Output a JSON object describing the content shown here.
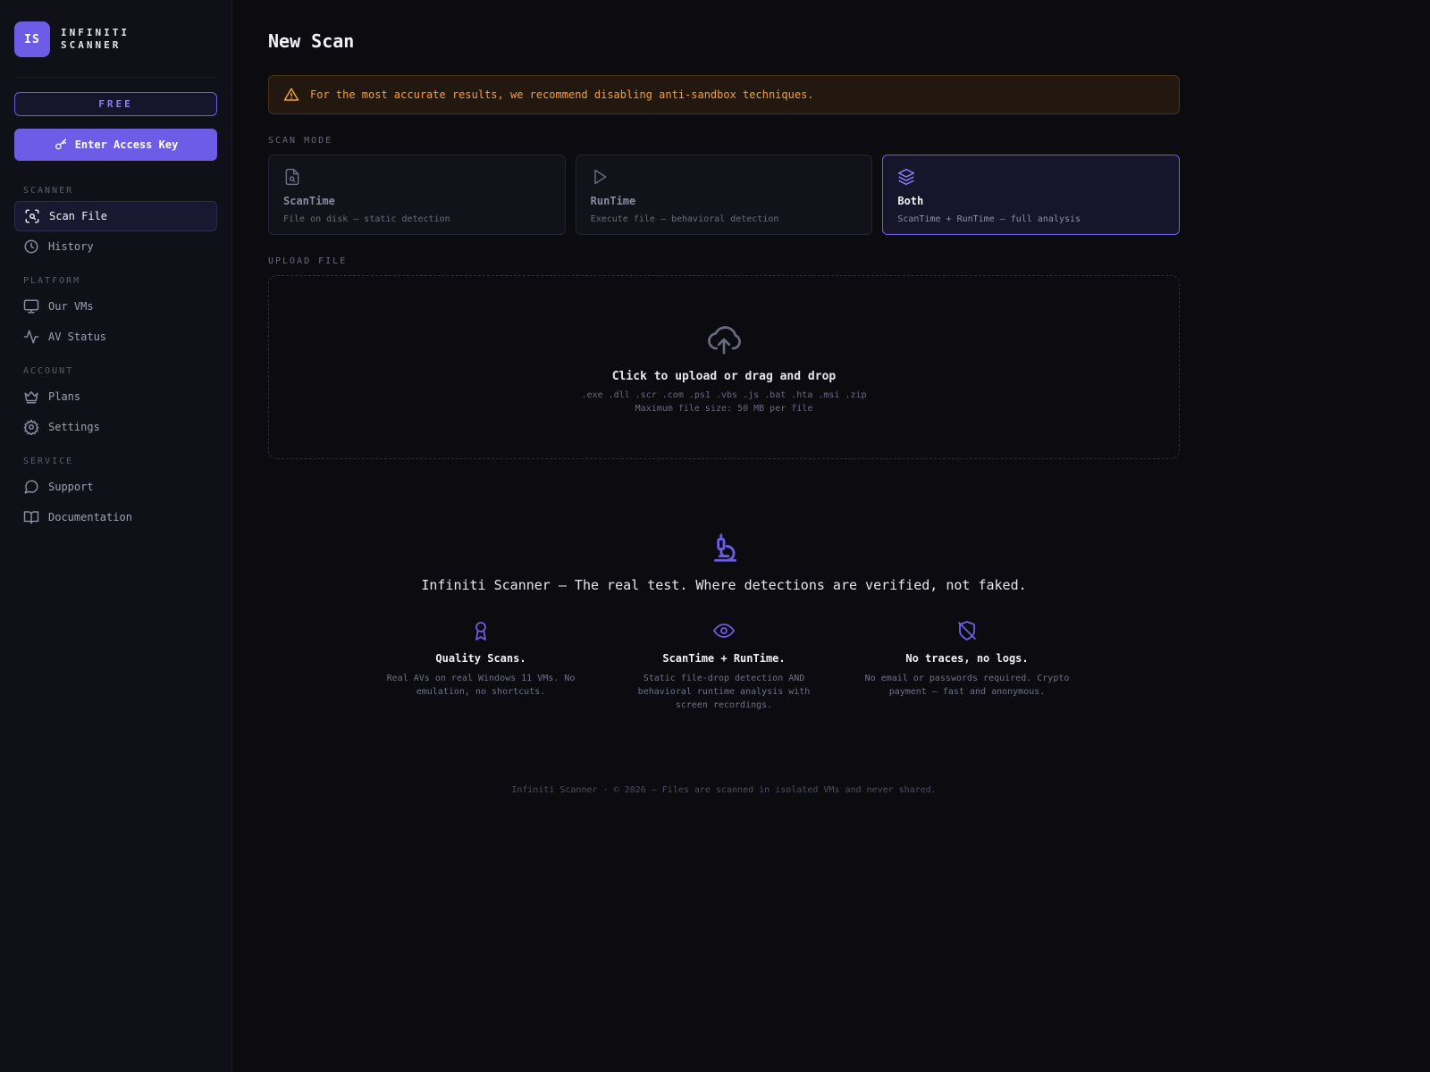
{
  "brand": {
    "logo_text": "IS",
    "name": "INFINITI SCANNER"
  },
  "plan_badge": "FREE",
  "access_button": {
    "label": "Enter Access Key",
    "icon": "key-icon"
  },
  "nav": {
    "scanner_label": "SCANNER",
    "platform_label": "PLATFORM",
    "account_label": "ACCOUNT",
    "service_label": "SERVICE",
    "items": [
      {
        "label": "Scan File",
        "icon": "scan-icon",
        "active": true
      },
      {
        "label": "History",
        "icon": "clock-icon"
      },
      {
        "label": "Our VMs",
        "icon": "monitor-icon"
      },
      {
        "label": "AV Status",
        "icon": "activity-icon"
      },
      {
        "label": "Plans",
        "icon": "crown-icon"
      },
      {
        "label": "Settings",
        "icon": "gear-icon"
      },
      {
        "label": "Support",
        "icon": "chat-icon"
      },
      {
        "label": "Documentation",
        "icon": "book-icon"
      }
    ]
  },
  "page_title": "New Scan",
  "warning": "For the most accurate results, we recommend disabling anti-sandbox techniques.",
  "scan_mode_label": "SCAN MODE",
  "modes": [
    {
      "name": "ScanTime",
      "desc": "File on disk — static detection",
      "icon": "file-search-icon"
    },
    {
      "name": "RunTime",
      "desc": "Execute file — behavioral detection",
      "icon": "play-icon"
    },
    {
      "name": "Both",
      "desc": "ScanTime + RunTime — full analysis",
      "icon": "layers-icon",
      "selected": true
    }
  ],
  "upload_label": "UPLOAD FILE",
  "upload": {
    "title": "Click to upload or drag and drop",
    "types": ".exe .dll .scr .com .ps1 .vbs .js .bat .hta .msi .zip",
    "limit": "Maximum file size: 50 MB per file"
  },
  "hero": {
    "title": "Infiniti Scanner — The real test. Where detections are verified, not faked."
  },
  "features": [
    {
      "title": "Quality Scans.",
      "desc": "Real AVs on real Windows 11 VMs. No emulation, no shortcuts.",
      "icon": "award-icon"
    },
    {
      "title": "ScanTime + RunTime.",
      "desc": "Static file-drop detection AND behavioral runtime analysis with screen recordings.",
      "icon": "eye-icon"
    },
    {
      "title": "No traces, no logs.",
      "desc": "No email or passwords required. Crypto payment — fast and anonymous.",
      "icon": "shield-off-icon"
    }
  ],
  "footer": "Infiniti Scanner · © 2026 — Files are scanned in isolated VMs and never shared.",
  "colors": {
    "accent": "#6d5ce6",
    "warning": "#f59e3b",
    "background": "#0b0b10",
    "sidebar": "#101018"
  }
}
